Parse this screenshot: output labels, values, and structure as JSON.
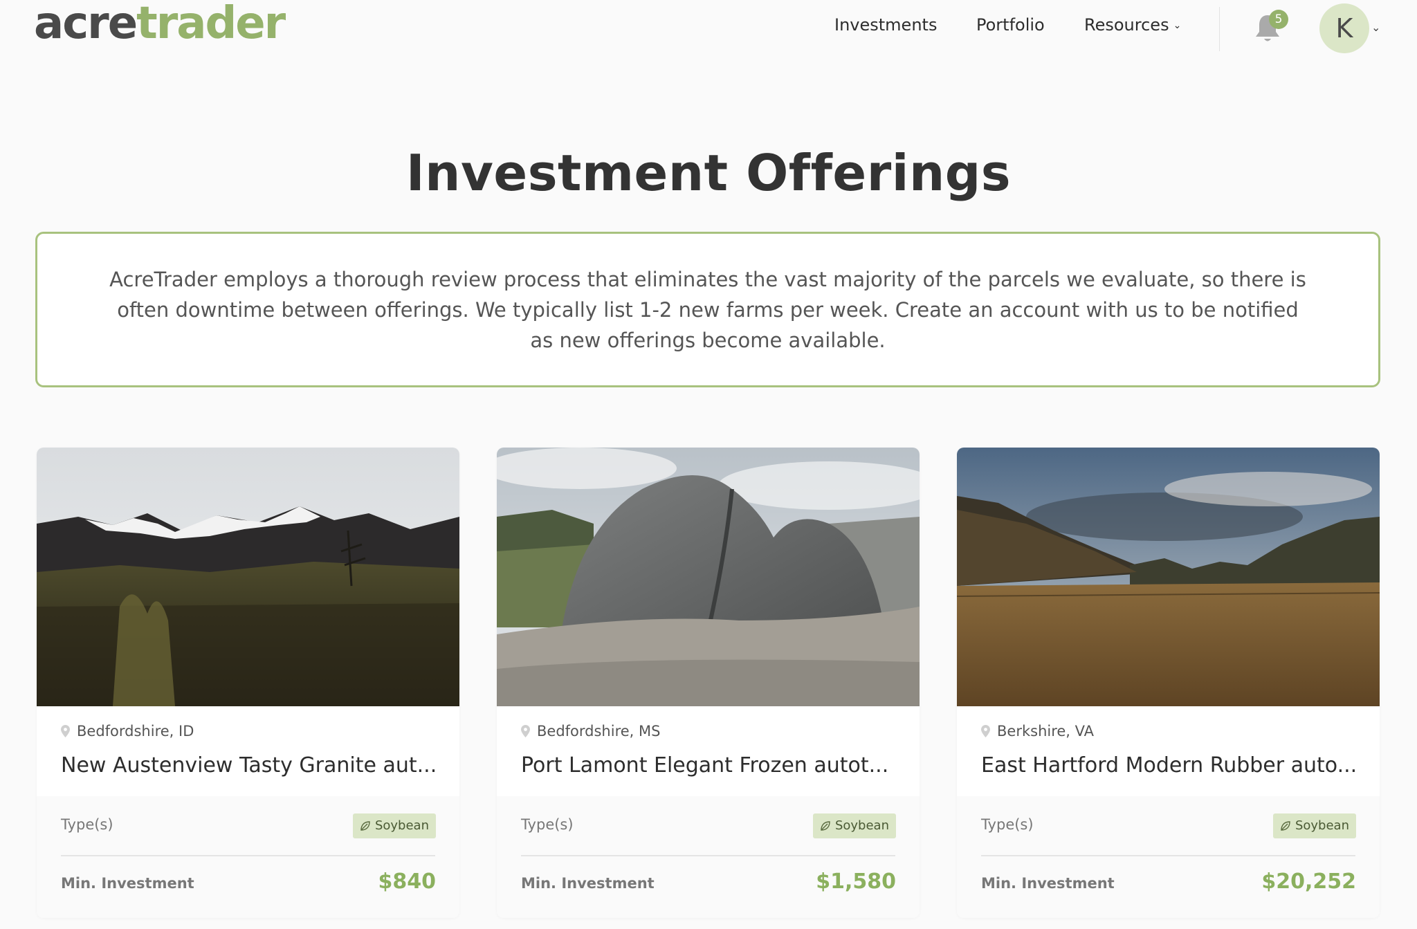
{
  "brand": {
    "part1": "acre",
    "part2": "trader"
  },
  "nav": {
    "items": [
      {
        "label": "Investments"
      },
      {
        "label": "Portfolio"
      },
      {
        "label": "Resources",
        "has_dropdown": true
      }
    ],
    "notification_count": "5",
    "avatar_initial": "K"
  },
  "page": {
    "title": "Investment Offerings",
    "notice": "AcreTrader employs a thorough review process that eliminates the vast majority of the parcels we evaluate, so there is often downtime between offerings. We typically list 1-2 new farms per week. Create an account with us to be notified as new offerings become available."
  },
  "cards": [
    {
      "location": "Bedfordshire, ID",
      "title": "New Austenview Tasty Granite aut...",
      "types_label": "Type(s)",
      "tag": "Soybean",
      "min_label": "Min. Investment",
      "min_value": "$840",
      "image": "snowy-mountains-meadow"
    },
    {
      "location": "Bedfordshire, MS",
      "title": "Port Lamont Elegant Frozen autot...",
      "types_label": "Type(s)",
      "tag": "Soybean",
      "min_label": "Min. Investment",
      "min_value": "$1,580",
      "image": "granite-rock-dome"
    },
    {
      "location": "Berkshire, VA",
      "title": "East Hartford Modern Rubber auto...",
      "types_label": "Type(s)",
      "tag": "Soybean",
      "min_label": "Min. Investment",
      "min_value": "$20,252",
      "image": "golden-valley-field"
    }
  ],
  "colors": {
    "accent": "#95b26b",
    "price": "#8bb05e",
    "tag_bg": "#dbe6c7",
    "notice_border": "#a8c27e"
  }
}
